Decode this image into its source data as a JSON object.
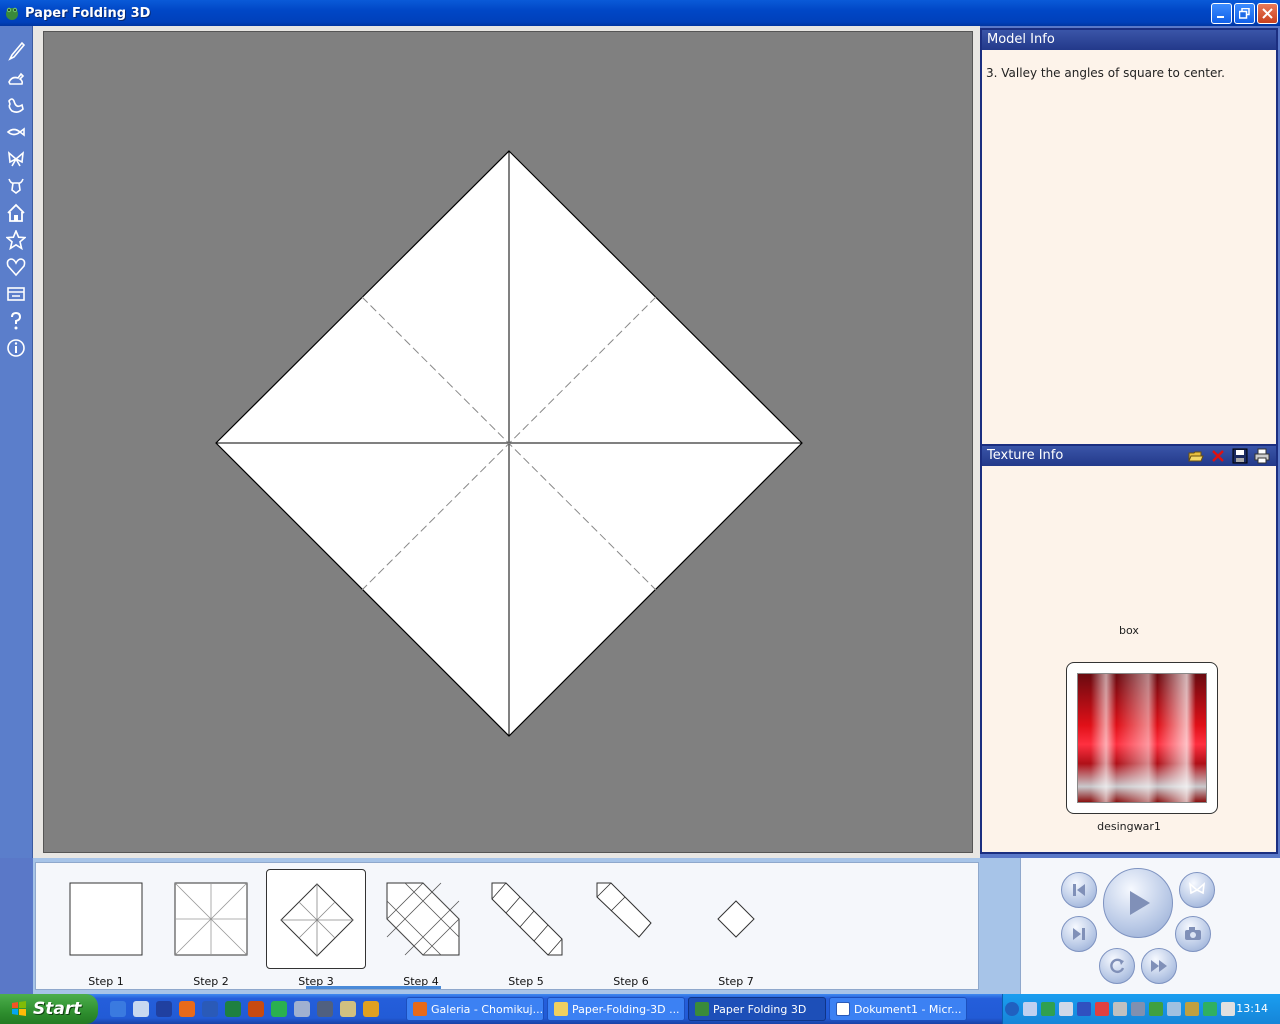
{
  "window": {
    "title": "Paper Folding 3D"
  },
  "left_toolbar": {
    "tools": [
      "brush-icon",
      "rabbit-icon",
      "rooster-icon",
      "fish-icon",
      "butterfly-icon",
      "bull-icon",
      "house-icon",
      "star-icon",
      "heart-icon",
      "box-icon",
      "help-icon",
      "info-icon"
    ]
  },
  "model_info": {
    "header": "Model Info",
    "text": "3. Valley the angles of square to center."
  },
  "texture_info": {
    "header": "Texture Info",
    "name": "box",
    "texture_label": "desingwar1",
    "icons": [
      "open-folder-icon",
      "delete-icon",
      "save-icon",
      "print-icon"
    ]
  },
  "steps": [
    {
      "label": "Step 1"
    },
    {
      "label": "Step 2"
    },
    {
      "label": "Step 3"
    },
    {
      "label": "Step 4"
    },
    {
      "label": "Step 5"
    },
    {
      "label": "Step 6"
    },
    {
      "label": "Step 7"
    }
  ],
  "selected_step": 3,
  "controls": [
    "first-step-icon",
    "play-icon",
    "butterfly-icon",
    "last-step-icon",
    "camera-icon",
    "rotate-icon",
    "fast-forward-icon"
  ],
  "taskbar": {
    "start_label": "Start",
    "tasks": [
      {
        "label": "Galeria - Chomikuj...",
        "active": false
      },
      {
        "label": "Paper-Folding-3D ...",
        "active": false
      },
      {
        "label": "Paper Folding 3D",
        "active": true
      },
      {
        "label": "Dokument1 - Micr...",
        "active": false
      }
    ],
    "clock": "13:14"
  }
}
